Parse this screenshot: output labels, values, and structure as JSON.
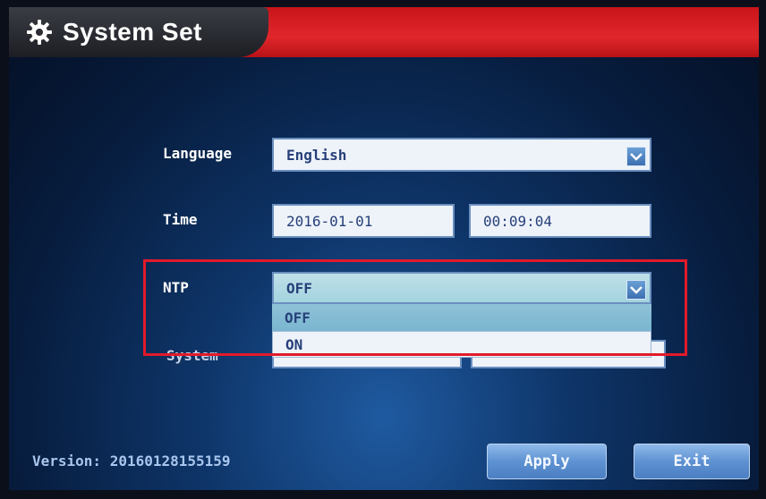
{
  "window": {
    "title": "System Set"
  },
  "form": {
    "language_label": "Language",
    "language_value": "English",
    "time_label": "Time",
    "date_value": "2016-01-01",
    "time_value": "00:09:04",
    "ntp_label": "NTP",
    "ntp_value": "OFF",
    "ntp_options": [
      "OFF",
      "ON"
    ],
    "system_label": "System"
  },
  "footer": {
    "version_text": "Version: 20160128155159",
    "apply_label": "Apply",
    "exit_label": "Exit"
  },
  "icons": {
    "title": "gear-icon",
    "dropdown": "chevron-down-icon"
  },
  "colors": {
    "title_bar": "#e0272c",
    "highlight_box": "#e21a2a",
    "button": "#5e92d2"
  }
}
